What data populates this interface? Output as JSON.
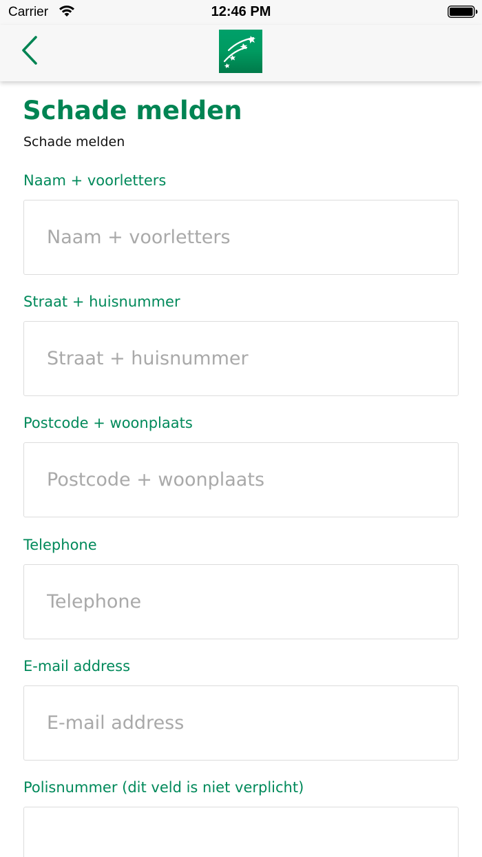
{
  "status_bar": {
    "carrier": "Carrier",
    "time": "12:46 PM",
    "icons": [
      "wifi-icon",
      "battery-icon"
    ]
  },
  "nav": {
    "back_icon": "chevron-left-icon",
    "logo_icon": "bnp-paribas-logo"
  },
  "colors": {
    "brand_green": "#008453",
    "label_green": "#00895a",
    "placeholder_gray": "#a9a9a9",
    "input_border": "#dcdcdc"
  },
  "page": {
    "title": "Schade melden",
    "subtitle": "Schade melden"
  },
  "form": {
    "fields": [
      {
        "label": "Naam + voorletters",
        "placeholder": "Naam + voorletters",
        "value": ""
      },
      {
        "label": "Straat + huisnummer",
        "placeholder": "Straat + huisnummer",
        "value": ""
      },
      {
        "label": "Postcode + woonplaats",
        "placeholder": "Postcode + woonplaats",
        "value": ""
      },
      {
        "label": "Telephone",
        "placeholder": "Telephone",
        "value": ""
      },
      {
        "label": "E-mail address",
        "placeholder": "E-mail address",
        "value": ""
      },
      {
        "label": "Polisnummer (dit veld is niet verplicht)",
        "placeholder": "",
        "value": ""
      }
    ]
  }
}
